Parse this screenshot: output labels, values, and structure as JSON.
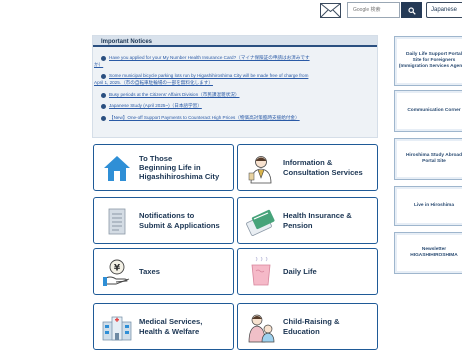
{
  "header": {
    "search_placeholder": "Google 検索",
    "language_selected": "Japanese"
  },
  "notices": {
    "title": "Important Notices",
    "items": [
      {
        "text": "Have you applied for your My Number Health Insurance Card?（マイナ保険証の申請はお済みです"
      },
      {
        "text": "か）"
      },
      {
        "text": "Some municipal bicycle parking lots run by Higashihiroshima City will be made free of charge from"
      },
      {
        "text": "April 1, 2025.（市の自転車駐輪場の一部を無料化します）"
      },
      {
        "text": "Busy periods at the Citizens' Affairs Division（市民課混雑状況）"
      },
      {
        "text": "Japanese Study (April 2025~)（日本語学習）"
      },
      {
        "text": "【New】One-off Support Payments to Counteract High Prices（物価高対策臨時支援給付金）"
      }
    ]
  },
  "categories": [
    {
      "label": "To Those\nBeginning Life in\nHigashihiroshima City",
      "icon": "house-icon"
    },
    {
      "label": "Information &\nConsultation Services",
      "icon": "staff-person-icon"
    },
    {
      "label": "Notifications to\nSubmit & Applications",
      "icon": "document-icon"
    },
    {
      "label": "Health Insurance &\nPension",
      "icon": "insurance-card-icon"
    },
    {
      "label": "Taxes",
      "icon": "yen-coin-hand-icon"
    },
    {
      "label": "Daily Life",
      "icon": "cup-icon"
    },
    {
      "label": "Medical Services,\nHealth & Welfare",
      "icon": "hospital-icon"
    },
    {
      "label": "Child-Raising &\nEducation",
      "icon": "parent-child-icon"
    }
  ],
  "sidebar": {
    "banners": [
      {
        "label": "Daily Life Support Portal\nSite for Foreigners\n(Immigration Services Agency)"
      },
      {
        "label": "Communication Corner"
      },
      {
        "label": "Hiroshima Study Abroad\nPortal Site"
      },
      {
        "label": "Live in Hiroshima"
      },
      {
        "label": "Newsletter\nHIGASHIHIROSHIMA"
      }
    ]
  },
  "colors": {
    "accent": "#1f5a97",
    "navy": "#1b3553",
    "link": "#2a5aa6"
  }
}
